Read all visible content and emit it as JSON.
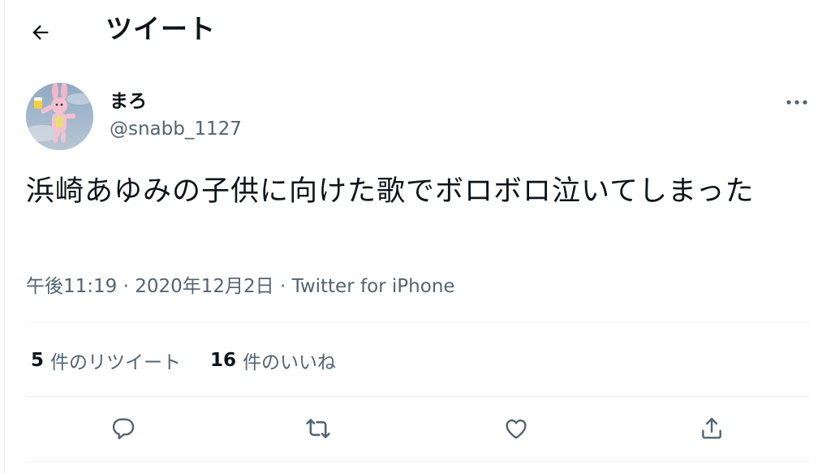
{
  "header": {
    "title": "ツイート"
  },
  "author": {
    "name": "まろ",
    "handle": "@snabb_1127"
  },
  "tweet": {
    "text": "浜崎あゆみの子供に向けた歌でボロボロ泣いてしまった",
    "meta": "午後11:19 · 2020年12月2日 · Twitter for iPhone"
  },
  "stats": {
    "retweets_count": "5",
    "retweets_label": "件のリツイート",
    "likes_count": "16",
    "likes_label": "件のいいね"
  },
  "icons": {
    "back": "arrow-left-icon",
    "more": "more-horizontal-icon",
    "reply": "reply-icon",
    "retweet": "retweet-icon",
    "like": "heart-icon",
    "share": "share-icon"
  },
  "colors": {
    "text_primary": "#0f1419",
    "text_secondary": "#536471",
    "divider": "#eff3f4"
  }
}
